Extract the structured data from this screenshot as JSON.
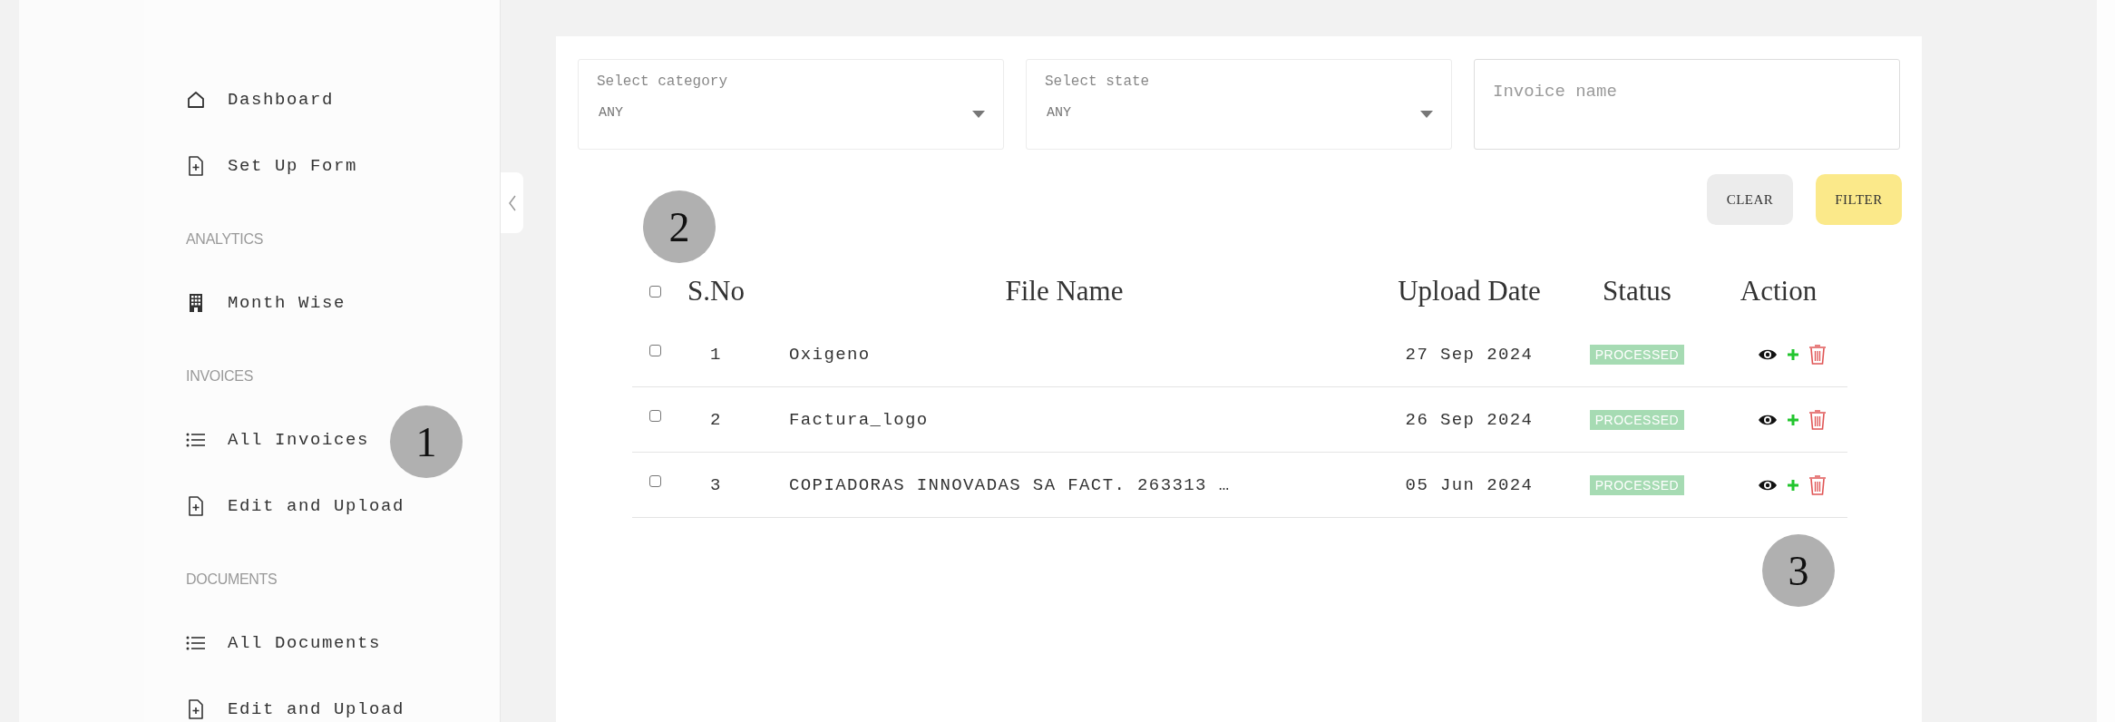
{
  "sidebar": {
    "items": [
      {
        "kind": "home",
        "label": "Dashboard"
      },
      {
        "kind": "file",
        "label": "Set Up Form"
      },
      {
        "kind": "heading",
        "label": "ANALYTICS"
      },
      {
        "kind": "building",
        "label": "Month Wise"
      },
      {
        "kind": "heading",
        "label": "INVOICES"
      },
      {
        "kind": "list",
        "label": "All Invoices"
      },
      {
        "kind": "file",
        "label": "Edit and Upload"
      },
      {
        "kind": "heading",
        "label": "DOCUMENTS"
      },
      {
        "kind": "list",
        "label": "All Documents"
      },
      {
        "kind": "file",
        "label": "Edit and Upload"
      }
    ]
  },
  "filters": {
    "fields": [
      {
        "kind": "select",
        "label": "Select category",
        "value": "ANY"
      },
      {
        "kind": "select",
        "label": "Select state",
        "value": "ANY"
      },
      {
        "kind": "text",
        "placeholder": "Invoice name"
      }
    ],
    "buttons": [
      {
        "kind": "secondary",
        "label": "CLEAR"
      },
      {
        "kind": "primary",
        "label": "FILTER"
      }
    ]
  },
  "table": {
    "select_all": {
      "checked": false
    },
    "columns": [
      "S.No",
      "File Name",
      "Upload Date",
      "Status",
      "Action"
    ],
    "rows": [
      {
        "checked": false,
        "sno": "1",
        "file_name": "Oxigeno",
        "upload_date": "27 Sep 2024",
        "status": "PROCESSED"
      },
      {
        "checked": false,
        "sno": "2",
        "file_name": "Factura_logo",
        "upload_date": "26 Sep 2024",
        "status": "PROCESSED"
      },
      {
        "checked": false,
        "sno": "3",
        "file_name": "COPIADORAS INNOVADAS SA FACT. 263313 …",
        "upload_date": "05 Jun 2024",
        "status": "PROCESSED"
      }
    ]
  },
  "callouts": [
    {
      "label": "1"
    },
    {
      "label": "2"
    },
    {
      "label": "3"
    }
  ]
}
